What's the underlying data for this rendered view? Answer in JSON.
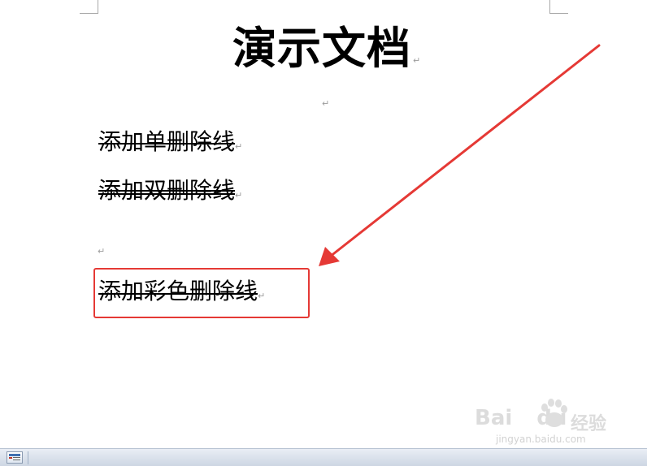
{
  "document": {
    "title": "演示文档",
    "lines": [
      {
        "text": "添加单删除线",
        "style": "single"
      },
      {
        "text": "添加双删除线",
        "style": "double"
      },
      {
        "text": "添加彩色删除线",
        "style": "colored"
      }
    ],
    "paragraph_mark": "↵"
  },
  "annotation": {
    "color": "#e53935"
  },
  "watermark": {
    "brand": "Bai",
    "brand_suffix": "du",
    "product": "经验",
    "url": "jingyan.baidu.com"
  },
  "statusbar": {
    "view_icon": "print-layout-icon"
  }
}
